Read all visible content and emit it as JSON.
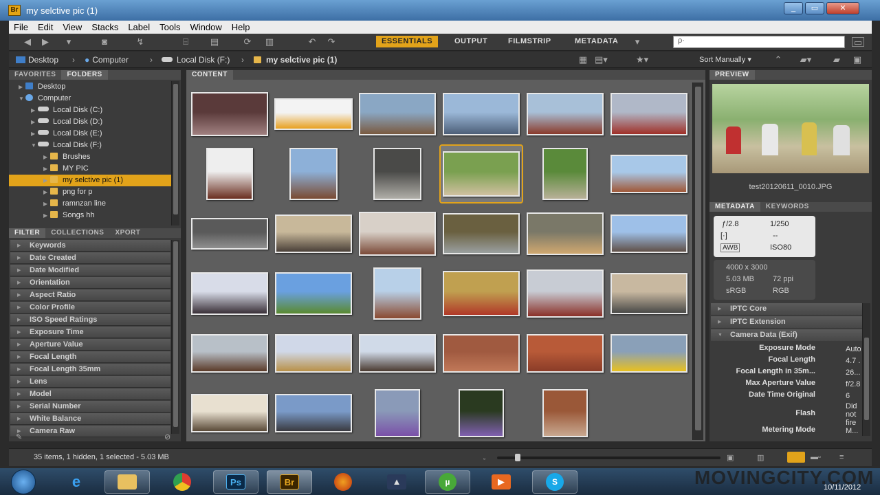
{
  "window": {
    "title": "my selctive pic (1)",
    "app_icon": "Br"
  },
  "menu": [
    "File",
    "Edit",
    "View",
    "Stacks",
    "Label",
    "Tools",
    "Window",
    "Help"
  ],
  "workspaces": [
    {
      "label": "ESSENTIALS",
      "active": true
    },
    {
      "label": "OUTPUT",
      "active": false
    },
    {
      "label": "FILMSTRIP",
      "active": false
    },
    {
      "label": "METADATA",
      "active": false
    }
  ],
  "search": {
    "placeholder": "ρ·"
  },
  "path": [
    "Desktop",
    "Computer",
    "Local Disk (F:)",
    "my selctive pic (1)"
  ],
  "sort": {
    "label": "Sort Manually"
  },
  "left": {
    "tabs": [
      "FAVORITES",
      "FOLDERS"
    ],
    "folders": [
      {
        "label": "Desktop",
        "kind": "desktop",
        "indent": 1
      },
      {
        "label": "Computer",
        "kind": "computer",
        "indent": 1
      },
      {
        "label": "Local Disk (C:)",
        "kind": "drive",
        "indent": 2
      },
      {
        "label": "Local Disk (D:)",
        "kind": "drive",
        "indent": 2
      },
      {
        "label": "Local Disk (E:)",
        "kind": "drive",
        "indent": 2
      },
      {
        "label": "Local Disk (F:)",
        "kind": "drive",
        "indent": 2
      },
      {
        "label": "Brushes",
        "kind": "folder",
        "indent": 3
      },
      {
        "label": "MY PIC",
        "kind": "folder",
        "indent": 3
      },
      {
        "label": "my selctive pic (1)",
        "kind": "folder",
        "indent": 3,
        "selected": true
      },
      {
        "label": "png for p",
        "kind": "folder",
        "indent": 3
      },
      {
        "label": "ramnzan line",
        "kind": "folder",
        "indent": 3
      },
      {
        "label": "Songs hh",
        "kind": "folder",
        "indent": 3
      }
    ],
    "filter_tabs": [
      "FILTER",
      "COLLECTIONS",
      "XPORT"
    ],
    "filters": [
      "Keywords",
      "Date Created",
      "Date Modified",
      "Orientation",
      "Aspect Ratio",
      "Color Profile",
      "ISO Speed Ratings",
      "Exposure Time",
      "Aperture Value",
      "Focal Length",
      "Focal Length 35mm",
      "Lens",
      "Model",
      "Serial Number",
      "White Balance",
      "Camera Raw"
    ]
  },
  "content": {
    "tab": "CONTENT"
  },
  "preview": {
    "tab": "PREVIEW",
    "filename": "test20120611_0010.JPG"
  },
  "metadata": {
    "tabs": [
      "METADATA",
      "KEYWORDS"
    ],
    "aperture": "ƒ/2.8",
    "shutter": "1/250",
    "metering_icon": "[·]",
    "exposure_comp": "--",
    "wb": "AWB",
    "iso": "ISO80",
    "dimensions": "4000 x 3000",
    "size": "5.03 MB",
    "ppi": "72 ppi",
    "color_space": "sRGB",
    "color_mode": "RGB",
    "sections": [
      "IPTC Core",
      "IPTC Extension",
      "Camera Data (Exif)"
    ],
    "exif": [
      {
        "k": "Exposure Mode",
        "v": "Auto"
      },
      {
        "k": "Focal Length",
        "v": "4.7 ..."
      },
      {
        "k": "Focal Length in 35m...",
        "v": "26...."
      },
      {
        "k": "Max Aperture Value",
        "v": "f/2.8"
      },
      {
        "k": "Date Time Original",
        "v": "6"
      },
      {
        "k": "Flash",
        "v": "Did\nnot\nfire"
      },
      {
        "k": "Metering Mode",
        "v": "M..."
      }
    ]
  },
  "status": {
    "text": "35 items, 1 hidden, 1 selected - 5.03 MB"
  },
  "taskbar": {
    "clock_time": "",
    "clock_date": "10/11/2012",
    "watermark": "MOVINGCITY.COM"
  },
  "thumbs": [
    {
      "c1": "#5a3a3a",
      "c2": "#a08080",
      "w": 112,
      "h": 64
    },
    {
      "c1": "#f3f3f3",
      "c2": "#e8a020",
      "w": 114,
      "h": 46
    },
    {
      "c1": "#8aa7c4",
      "c2": "#7a5a40",
      "w": 112,
      "h": 62
    },
    {
      "c1": "#9bb8d8",
      "c2": "#4d5f78",
      "w": 112,
      "h": 62
    },
    {
      "c1": "#a8c0d8",
      "c2": "#8a3a2a",
      "w": 112,
      "h": 62
    },
    {
      "c1": "#b0b8c8",
      "c2": "#a03028",
      "w": 112,
      "h": 62
    },
    {
      "c1": "#eeeeee",
      "c2": "#6a2e20",
      "w": 68,
      "h": 76
    },
    {
      "c1": "#8db0d8",
      "c2": "#7a4a32",
      "w": 70,
      "h": 76
    },
    {
      "c1": "#4a4a48",
      "c2": "#b0aea8",
      "w": 70,
      "h": 76
    },
    {
      "c1": "#7aa050",
      "c2": "#d0c0a0",
      "w": 112,
      "h": 66
    },
    {
      "c1": "#5a8a3a",
      "c2": "#b8b098",
      "w": 66,
      "h": 76
    },
    {
      "c1": "#a8c8e8",
      "c2": "#a05838",
      "w": 112,
      "h": 56
    },
    {
      "c1": "#5a5a5a",
      "c2": "#909090",
      "w": 112,
      "h": 46
    },
    {
      "c1": "#c8b89a",
      "c2": "#4a4038",
      "w": 112,
      "h": 56
    },
    {
      "c1": "#d8d0c8",
      "c2": "#7a4a38",
      "w": 112,
      "h": 64
    },
    {
      "c1": "#6a6040",
      "c2": "#9aa0a0",
      "w": 112,
      "h": 60
    },
    {
      "c1": "#7a7868",
      "c2": "#d0a870",
      "w": 112,
      "h": 62
    },
    {
      "c1": "#9ec0e8",
      "c2": "#605048",
      "w": 112,
      "h": 56
    },
    {
      "c1": "#d8dce8",
      "c2": "#3a3038",
      "w": 112,
      "h": 62
    },
    {
      "c1": "#6aa0e0",
      "c2": "#5a8a30",
      "w": 112,
      "h": 62
    },
    {
      "c1": "#b8d0e8",
      "c2": "#8a4a30",
      "w": 70,
      "h": 76
    },
    {
      "c1": "#c0a050",
      "c2": "#b03828",
      "w": 112,
      "h": 66
    },
    {
      "c1": "#c8ccd4",
      "c2": "#8a3028",
      "w": 112,
      "h": 70
    },
    {
      "c1": "#c8b8a0",
      "c2": "#4a4a48",
      "w": 112,
      "h": 60
    },
    {
      "c1": "#b8c0c8",
      "c2": "#5a3a28",
      "w": 112,
      "h": 56
    },
    {
      "c1": "#d0d8e8",
      "c2": "#b89048",
      "w": 112,
      "h": 56
    },
    {
      "c1": "#d0dae8",
      "c2": "#4a3a30",
      "w": 112,
      "h": 56
    },
    {
      "c1": "#a05a40",
      "c2": "#c07858",
      "w": 112,
      "h": 56
    },
    {
      "c1": "#b85a38",
      "c2": "#8a3c28",
      "w": 112,
      "h": 56
    },
    {
      "c1": "#8aa0b8",
      "c2": "#e8c020",
      "w": 112,
      "h": 56
    },
    {
      "c1": "#e8e0d0",
      "c2": "#5a4a38",
      "w": 112,
      "h": 56
    },
    {
      "c1": "#7a9ac8",
      "c2": "#3a3a40",
      "w": 112,
      "h": 56
    },
    {
      "c1": "#8a9ab8",
      "c2": "#7a50a8",
      "w": 66,
      "h": 70
    },
    {
      "c1": "#2a3a20",
      "c2": "#8060b0",
      "w": 66,
      "h": 70
    },
    {
      "c1": "#9a5838",
      "c2": "#c8a890",
      "w": 66,
      "h": 70
    }
  ]
}
